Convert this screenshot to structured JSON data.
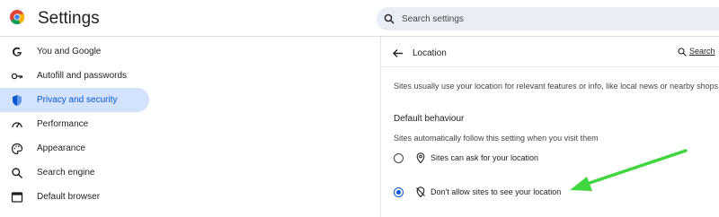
{
  "header": {
    "title": "Settings",
    "logo_icon": "chrome-logo-icon",
    "search_placeholder": "Search settings"
  },
  "sidebar": {
    "items": [
      {
        "label": "You and Google",
        "icon": "google-g-icon"
      },
      {
        "label": "Autofill and passwords",
        "icon": "key-icon"
      },
      {
        "label": "Privacy and security",
        "icon": "shield-icon",
        "selected": true
      },
      {
        "label": "Performance",
        "icon": "speedometer-icon"
      },
      {
        "label": "Appearance",
        "icon": "palette-icon"
      },
      {
        "label": "Search engine",
        "icon": "search-icon"
      },
      {
        "label": "Default browser",
        "icon": "browser-window-icon"
      }
    ]
  },
  "panel": {
    "title": "Location",
    "search_label": "Search",
    "description": "Sites usually use your location for relevant features or info, like local news or nearby shops",
    "default_heading": "Default behaviour",
    "default_sub": "Sites automatically follow this setting when you visit them",
    "options": [
      {
        "label": "Sites can ask for your location",
        "icon": "location-pin-icon",
        "checked": false
      },
      {
        "label": "Don't allow sites to see your location",
        "icon": "location-off-icon",
        "checked": true
      }
    ]
  },
  "colors": {
    "accent": "#0b57d0",
    "selected_bg": "#d3e3fd",
    "search_bg": "#e9eef6",
    "annotation_arrow": "#3fd63f"
  }
}
